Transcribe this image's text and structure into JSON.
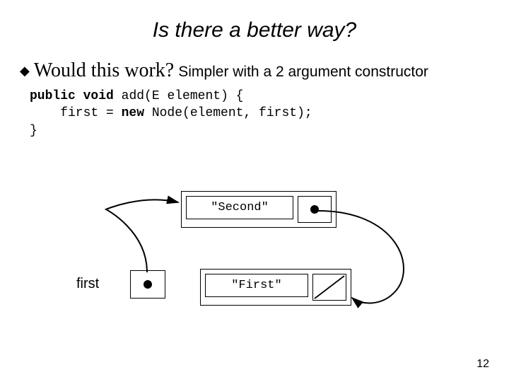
{
  "title": "Is there a better way?",
  "bullet": {
    "question": "Would this work?",
    "subnote": "Simpler with a 2 argument constructor"
  },
  "code": {
    "kw_public": "public",
    "kw_void": "void",
    "fn": " add(E element) {",
    "line2a": "    first = ",
    "kw_new": "new",
    "line2b": " Node(element, first);",
    "close": "}"
  },
  "diagram": {
    "node_top_label": "\"Second\"",
    "node_bottom_label": "\"First\"",
    "first_label": "first"
  },
  "page_number": "12"
}
